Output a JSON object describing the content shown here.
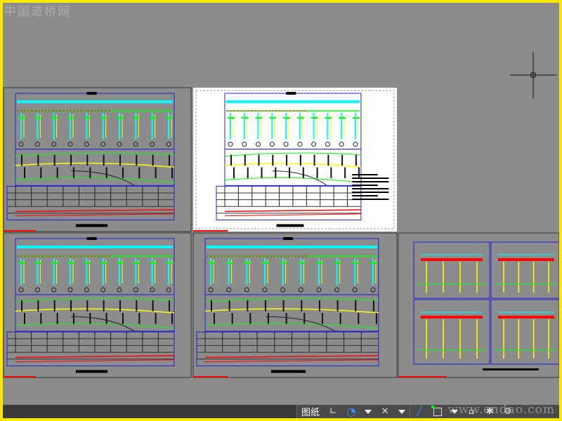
{
  "watermark": {
    "top": "中国道桥网",
    "bottom": "www.cndao.com"
  },
  "status_bar": {
    "layout_label": "图纸"
  },
  "icons": [
    "snap-mode-icon",
    "polar-tracking-icon",
    "object-snap-icon",
    "lineweight-icon",
    "selection-cycling-icon",
    "annotation-icon",
    "workspace-icon",
    "settings-gear-icon"
  ],
  "colors": {
    "background": "#8c8c8c",
    "border": "#ffe800",
    "frame": "#2020d0",
    "cyan": "#00ffff",
    "green": "#00ff00",
    "yellow": "#ffff00",
    "red": "#ff0000"
  }
}
